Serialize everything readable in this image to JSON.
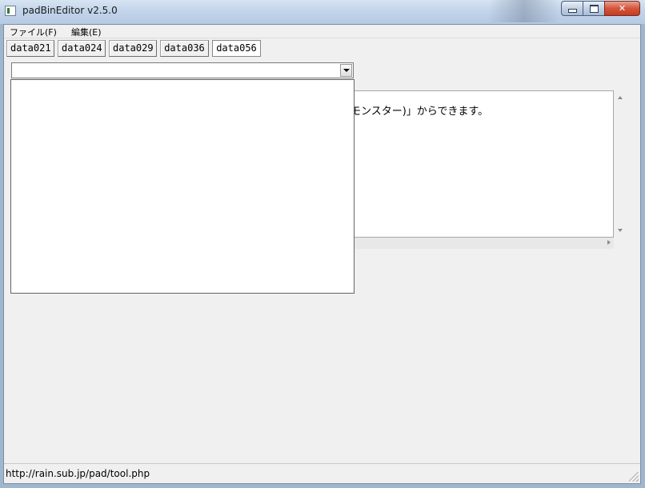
{
  "window": {
    "title": "padBinEditor v2.5.0"
  },
  "menu": {
    "items": [
      "ファイル(F)",
      "編集(E)"
    ]
  },
  "tabs": [
    "data021",
    "data024",
    "data029",
    "data036",
    "data056"
  ],
  "active_tab": "data056",
  "combobox": {
    "value": ""
  },
  "textbox": {
    "visible_text": "モンスター)」からできます。"
  },
  "statusbar": {
    "text": "http://rain.sub.jp/pad/tool.php"
  },
  "colors": {
    "titlebar": "#c3d5ea",
    "client_bg": "#f0f0f0",
    "close_button": "#c23b22"
  },
  "icons": {
    "app": "app-window-icon",
    "minimize": "minimize-icon",
    "maximize": "maximize-icon",
    "close": "close-icon",
    "dropdown": "chevron-down-icon"
  }
}
